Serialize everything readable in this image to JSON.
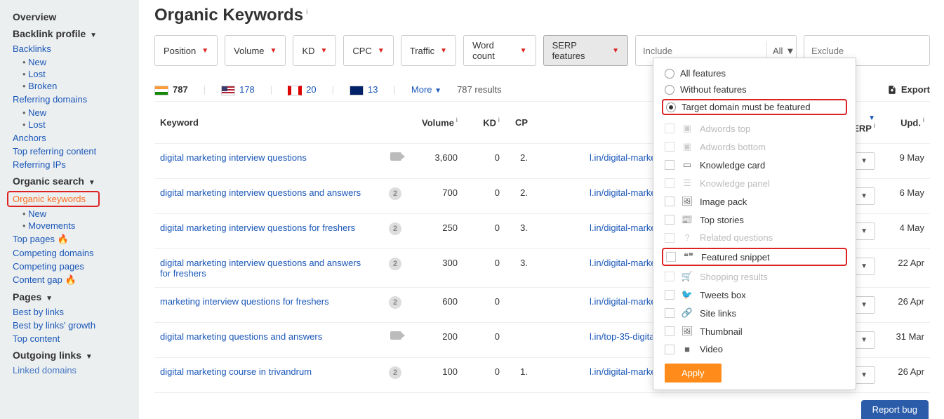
{
  "sidebar": {
    "overview": "Overview",
    "backlink_profile": "Backlink profile",
    "backlinks": "Backlinks",
    "backlinks_new": "New",
    "backlinks_lost": "Lost",
    "backlinks_broken": "Broken",
    "referring_domains": "Referring domains",
    "refdom_new": "New",
    "refdom_lost": "Lost",
    "anchors": "Anchors",
    "top_ref_content": "Top referring content",
    "referring_ips": "Referring IPs",
    "organic_search": "Organic search",
    "organic_keywords": "Organic keywords",
    "ok_new": "New",
    "ok_movements": "Movements",
    "top_pages": "Top pages",
    "competing_domains": "Competing domains",
    "competing_pages": "Competing pages",
    "content_gap": "Content gap",
    "pages": "Pages",
    "best_by_links": "Best by links",
    "best_by_growth": "Best by links' growth",
    "top_content": "Top content",
    "outgoing": "Outgoing links",
    "linked_domains": "Linked domains"
  },
  "page": {
    "title": "Organic Keywords",
    "export": "Export"
  },
  "filters": {
    "position": "Position",
    "volume": "Volume",
    "kd": "KD",
    "cpc": "CPC",
    "traffic": "Traffic",
    "word_count": "Word count",
    "serp_features": "SERP features",
    "include_ph": "Include",
    "include_mode": "All",
    "exclude_ph": "Exclude"
  },
  "countries": {
    "in": "787",
    "us": "178",
    "ca": "20",
    "au": "13",
    "more": "More",
    "results": "787 results"
  },
  "headers": {
    "keyword": "Keyword",
    "volume": "Volume",
    "kd": "KD",
    "cpc": "CP",
    "url": "",
    "serp": "SERP",
    "upd": "Upd."
  },
  "rows": [
    {
      "kw": "digital marketing interview questions",
      "icon": "cam",
      "vol": "3,600",
      "kd": "0",
      "cpc": "2.",
      "url": "l.in/digital-marke w-questions/",
      "serp": "SERP",
      "upd": "9 May"
    },
    {
      "kw": "digital marketing interview questions and answers",
      "icon": "2",
      "vol": "700",
      "kd": "0",
      "cpc": "2.",
      "url": "l.in/digital-marke w-questions/",
      "serp": "SERP",
      "upd": "6 May"
    },
    {
      "kw": "digital marketing interview questions for freshers",
      "icon": "2",
      "vol": "250",
      "kd": "0",
      "cpc": "3.",
      "url": "l.in/digital-marke w-questions/",
      "serp": "SERP",
      "upd": "4 May"
    },
    {
      "kw": "digital marketing interview questions and answers for freshers",
      "icon": "2",
      "vol": "300",
      "kd": "0",
      "cpc": "3.",
      "url": "l.in/digital-marke w-questions/",
      "serp": "SERP",
      "upd": "22 Apr"
    },
    {
      "kw": "marketing interview questions for freshers",
      "icon": "2",
      "vol": "600",
      "kd": "0",
      "cpc": "",
      "url": "l.in/digital-marke w-questions/",
      "serp": "SERP",
      "upd": "26 Apr"
    },
    {
      "kw": "digital marketing questions and answers",
      "icon": "cam",
      "vol": "200",
      "kd": "0",
      "cpc": "",
      "url": "l.in/top-35-digital interview-questio",
      "serp": "SERP",
      "upd": "31 Mar"
    },
    {
      "kw": "digital marketing course in trivandrum",
      "icon": "2",
      "vol": "100",
      "kd": "0",
      "cpc": "1.",
      "url": "l.in/digital-marke s-trivandrum/",
      "serp": "SERP",
      "upd": "26 Apr"
    }
  ],
  "dropdown": {
    "all": "All features",
    "without": "Without features",
    "target": "Target domain must be featured",
    "adwords_top": "Adwords top",
    "adwords_bottom": "Adwords bottom",
    "knowledge_card": "Knowledge card",
    "knowledge_panel": "Knowledge panel",
    "image_pack": "Image pack",
    "top_stories": "Top stories",
    "related_q": "Related questions",
    "featured_snippet": "Featured snippet",
    "shopping": "Shopping results",
    "tweets": "Tweets box",
    "site_links": "Site links",
    "thumbnail": "Thumbnail",
    "video": "Video",
    "apply": "Apply"
  },
  "misc": {
    "report_bug": "Report bug"
  }
}
